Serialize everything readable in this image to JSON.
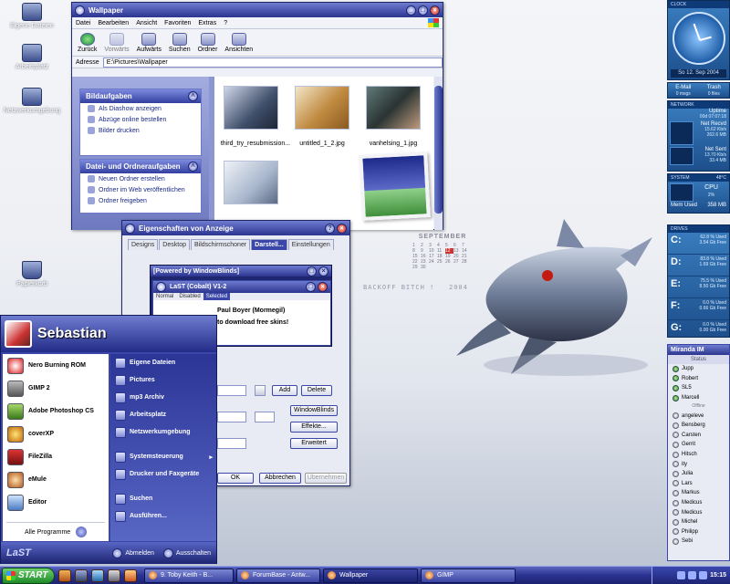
{
  "desktop": {
    "icons": [
      "Eigene Dateien",
      "Arbeitsplatz",
      "Netzwerkumgebung",
      "Papierkorb"
    ],
    "calendar": {
      "month": "SEPTEMBER",
      "days": [
        "1",
        "2",
        "3",
        "4",
        "5",
        "6",
        "7",
        "8",
        "9",
        "10",
        "11",
        "12",
        "13",
        "14",
        "15",
        "16",
        "17",
        "18",
        "19",
        "20",
        "21",
        "22",
        "23",
        "24",
        "25",
        "26",
        "27",
        "28",
        "29",
        "30"
      ],
      "today": "12"
    },
    "wallpaper_text": {
      "left": "BACKOFF BITCH !",
      "right": "2004"
    }
  },
  "explorer": {
    "title": "Wallpaper",
    "menu": [
      "Datei",
      "Bearbeiten",
      "Ansicht",
      "Favoriten",
      "Extras",
      "?"
    ],
    "toolbar": [
      "Zurück",
      "Vorwärts",
      "Aufwärts",
      "Suchen",
      "Ordner",
      "Ansichten"
    ],
    "address_label": "Adresse",
    "address_value": "E:\\Pictures\\Wallpaper",
    "panel1": {
      "title": "Bildaufgaben",
      "items": [
        "Als Diashow anzeigen",
        "Abzüge online bestellen",
        "Bilder drucken"
      ]
    },
    "panel2": {
      "title": "Datei- und Ordneraufgaben",
      "items": [
        "Neuen Ordner erstellen",
        "Ordner im Web veröffentlichen",
        "Ordner freigeben"
      ]
    },
    "files": [
      "third_try_resubmission...",
      "untitled_1_2.jpg",
      "vanhelsing_1.jpg",
      ""
    ]
  },
  "display": {
    "title": "Eigenschaften von Anzeige",
    "tabs": [
      "Designs",
      "Desktop",
      "Bildschirmschoner",
      "Darstell...",
      "Einstellungen"
    ],
    "inner_title": "[Powered by WindowBlinds]",
    "inner2_title": "LaST (Cobalt) V1-2",
    "inner2_tabs": [
      "Normal",
      "Disabled",
      "Selected"
    ],
    "preview_line1": "Paul Boyer (Mormegil)",
    "preview_line2": "to download free skins!",
    "buttons": {
      "add": "Add",
      "delete": "Delete",
      "windowblinds": "WindowBlinds",
      "effekte": "Effekte...",
      "erweitert": "Erweitert",
      "ok": "OK",
      "abbrechen": "Abbrechen",
      "uebernehmen": "Übernehmen"
    }
  },
  "startmenu": {
    "user": "Sebastian",
    "left_items": [
      "Nero Burning ROM",
      "GIMP 2",
      "Adobe Photoshop CS",
      "coverXP",
      "FileZilla",
      "eMule",
      "Editor"
    ],
    "all_programs": "Alle Programme",
    "right_items": [
      "Eigene Dateien",
      "Pictures",
      "mp3 Archiv",
      "Arbeitsplatz",
      "Netzwerkumgebung"
    ],
    "right_items2": [
      "Systemsteuerung",
      "Drucker und Faxgeräte"
    ],
    "right_items3": [
      "Suchen",
      "Ausführen..."
    ],
    "logo": "LaST",
    "logoff": "Abmelden",
    "shutdown": "Ausschalten"
  },
  "sidebar": {
    "clock_label": "CLOCK",
    "date": "So 12. Sep 2004",
    "email_label": "E-Mail",
    "email_count": "0 msgs",
    "trash_label": "Trash",
    "trash_count": "0 files",
    "network_label": "NETWORK",
    "uptime_label": "Uptime",
    "uptime_value": "00d 07:07:18",
    "recv_label": "Net Recvd",
    "recv_rate": "15.62 Kb/s",
    "recv_total": "262.6 MB",
    "sent_label": "Net Sent",
    "sent_rate": "13.70 Kb/s",
    "sent_total": "33.4 MB",
    "system_label": "SYSTEM",
    "temp": "48°C",
    "cpu_label": "CPU",
    "cpu_value": "2%",
    "mem_label": "Mem Used",
    "mem_value": "358 MB",
    "drives_label": "DRIVES",
    "drives": [
      {
        "letter": "C:",
        "line1": "62.8 % Used",
        "line2": "3.54 Gb Free"
      },
      {
        "letter": "D:",
        "line1": "83.8 % Used",
        "line2": "1.69 Gb Free"
      },
      {
        "letter": "E:",
        "line1": "75.5 % Used",
        "line2": "8.50 Gb Free"
      },
      {
        "letter": "F:",
        "line1": "0.0 % Used",
        "line2": "0.66 Gb Free"
      },
      {
        "letter": "G:",
        "line1": "0.0 % Used",
        "line2": "0.00 Gb Free"
      }
    ]
  },
  "miranda": {
    "title": "Miranda IM",
    "status_label": "Status",
    "online": [
      "Jupp",
      "Robert",
      "SL5",
      "Marcell"
    ],
    "group": "Offline",
    "offline": [
      "angeleve",
      "Bensberg",
      "Carsten",
      "Gerrit",
      "Hitsch",
      "ity",
      "Julia",
      "Lars",
      "Markus",
      "Medicus",
      "Medicus",
      "Michel",
      "Philipp",
      "Sebi"
    ]
  },
  "taskbar": {
    "start": "START",
    "tasks": [
      "9. Toby Keith - B...",
      "ForumBase - Antw...",
      "Wallpaper",
      "GIMP"
    ],
    "time": "15:15"
  }
}
